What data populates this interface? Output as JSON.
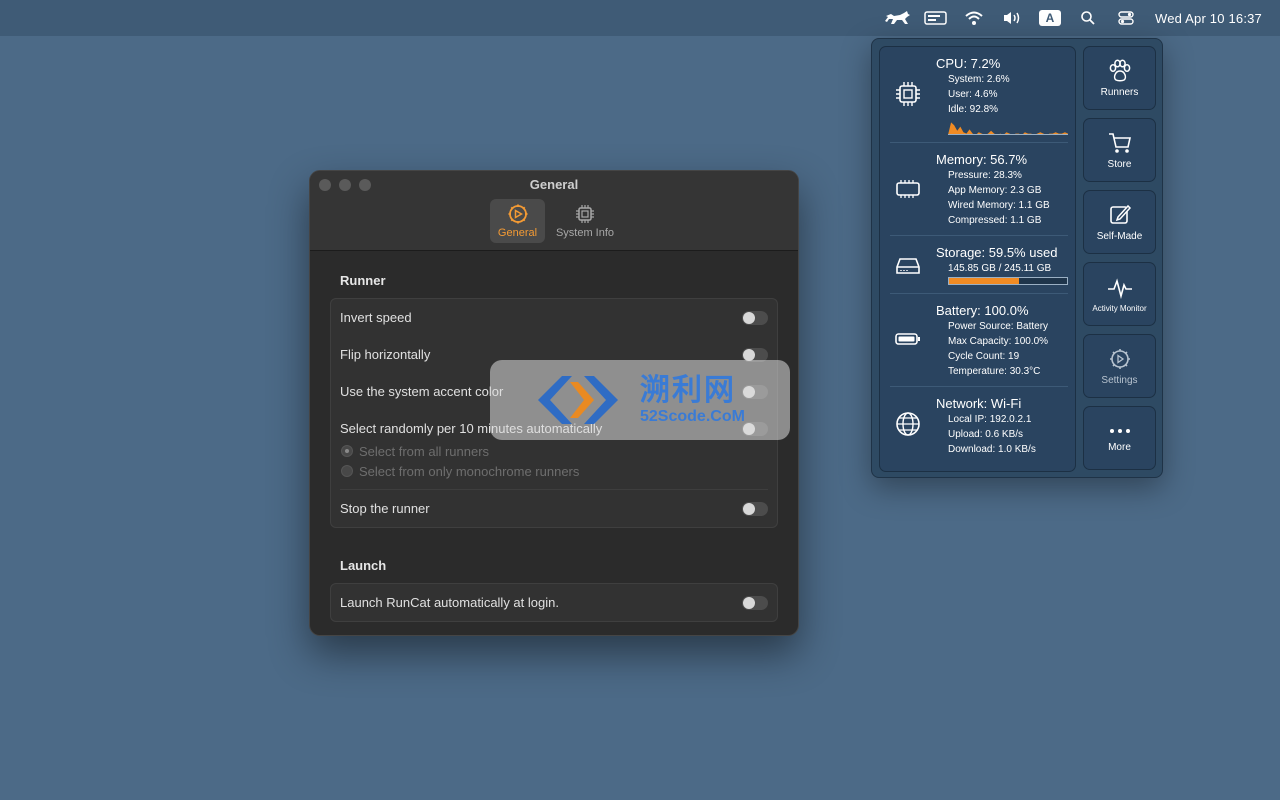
{
  "menubar": {
    "clock": "Wed Apr 10  16:37",
    "input_source": "A",
    "icons": [
      "runcat-icon",
      "battery-card-icon",
      "wifi-icon",
      "volume-icon",
      "input-source-icon",
      "search-icon",
      "control-center-icon"
    ]
  },
  "window": {
    "title": "General",
    "tabs": [
      {
        "label": "General",
        "icon": "gear-icon",
        "active": true
      },
      {
        "label": "System Info",
        "icon": "chip-icon",
        "active": false
      }
    ],
    "runner_section": {
      "title": "Runner",
      "invert_speed": "Invert speed",
      "flip_horizontally": "Flip horizontally",
      "accent_color": "Use the system accent color",
      "select_randomly": "Select randomly per 10 minutes automatically",
      "radio_all": "Select from all runners",
      "radio_mono": "Select from only monochrome runners",
      "stop_runner": "Stop the runner"
    },
    "launch_section": {
      "title": "Launch",
      "launch_at_login": "Launch RunCat automatically at login."
    }
  },
  "watermark": {
    "chinese": "溯利网",
    "url": "52Scode.CoM"
  },
  "popover": {
    "cpu": {
      "head": "CPU:  7.2%",
      "system": "System:  2.6%",
      "user": "User:  4.6%",
      "idle": "Idle:  92.8%",
      "history": [
        0,
        9,
        7,
        3,
        6,
        2,
        1,
        4,
        1,
        0,
        2,
        1,
        0,
        1,
        3,
        1,
        0,
        1,
        0,
        2,
        1,
        0,
        1,
        1,
        0,
        2,
        1,
        1,
        0,
        1,
        2,
        1,
        0,
        1,
        1,
        2,
        1,
        1,
        2,
        1
      ]
    },
    "memory": {
      "head": "Memory: 56.7%",
      "pressure": "Pressure: 28.3%",
      "app": "App Memory:  2.3 GB",
      "wired": "Wired Memory:  1.1 GB",
      "compressed": "Compressed:  1.1 GB"
    },
    "storage": {
      "head": "Storage: 59.5% used",
      "detail": "145.85 GB / 245.11 GB",
      "used_fraction": 0.595
    },
    "battery": {
      "head": "Battery: 100.0%",
      "source": "Power Source: Battery",
      "max_capacity": "Max Capacity: 100.0%",
      "cycle_count": "Cycle Count: 19",
      "temperature": "Temperature: 30.3°C"
    },
    "network": {
      "head": "Network: Wi-Fi",
      "local_ip": "Local IP: 192.0.2.1",
      "upload": "Upload:   0.6 KB/s",
      "download": "Download:   1.0 KB/s"
    },
    "side_buttons": [
      {
        "label": "Runners",
        "icon": "paw-icon"
      },
      {
        "label": "Store",
        "icon": "cart-icon"
      },
      {
        "label": "Self-Made",
        "icon": "edit-icon"
      },
      {
        "label": "Activity Monitor",
        "icon": "pulse-icon"
      },
      {
        "label": "Settings",
        "icon": "gear-icon"
      },
      {
        "label": "More",
        "icon": "ellipsis-icon"
      }
    ]
  },
  "colors": {
    "desktop": "#4c6a87",
    "accent": "#f39a34",
    "storage_fill": "#f08b24",
    "watermark_text": "#3a7bd5"
  }
}
